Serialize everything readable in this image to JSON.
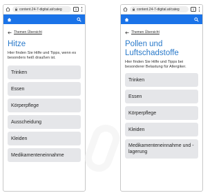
{
  "colors": {
    "accent": "#1a73e8",
    "title": "#2979c9",
    "item_bg": "#e5e6e9",
    "text": "#222222"
  },
  "browser": {
    "url": "content.24-7-digital.at/categ",
    "tab_count": "1",
    "icons": [
      "home-icon",
      "lock-icon",
      "tabs-icon",
      "menu-icon"
    ]
  },
  "appbar": {
    "icons": [
      "home-icon",
      "search-icon"
    ]
  },
  "screens": [
    {
      "back_label": "Themen Übersicht",
      "title": "Hitze",
      "description": "Hier finden Sie Hilfe und Tipps, wenn es besonders heiß draußen ist.",
      "items": [
        "Trinken",
        "Essen",
        "Körperpflege",
        "Ausscheidung",
        "Kleiden",
        "Medikamenteneinnahme"
      ]
    },
    {
      "back_label": "Themen Übersicht",
      "title": "Pollen und Luftschadstoffe",
      "description": "Hier finden Sie Hilfe und Tipps bei besonderer Belastung für Allergiker.",
      "items": [
        "Trinken",
        "Essen",
        "Körperpflege",
        "Kleiden",
        "Medikamenteneinnahme und -lagerung"
      ]
    }
  ]
}
